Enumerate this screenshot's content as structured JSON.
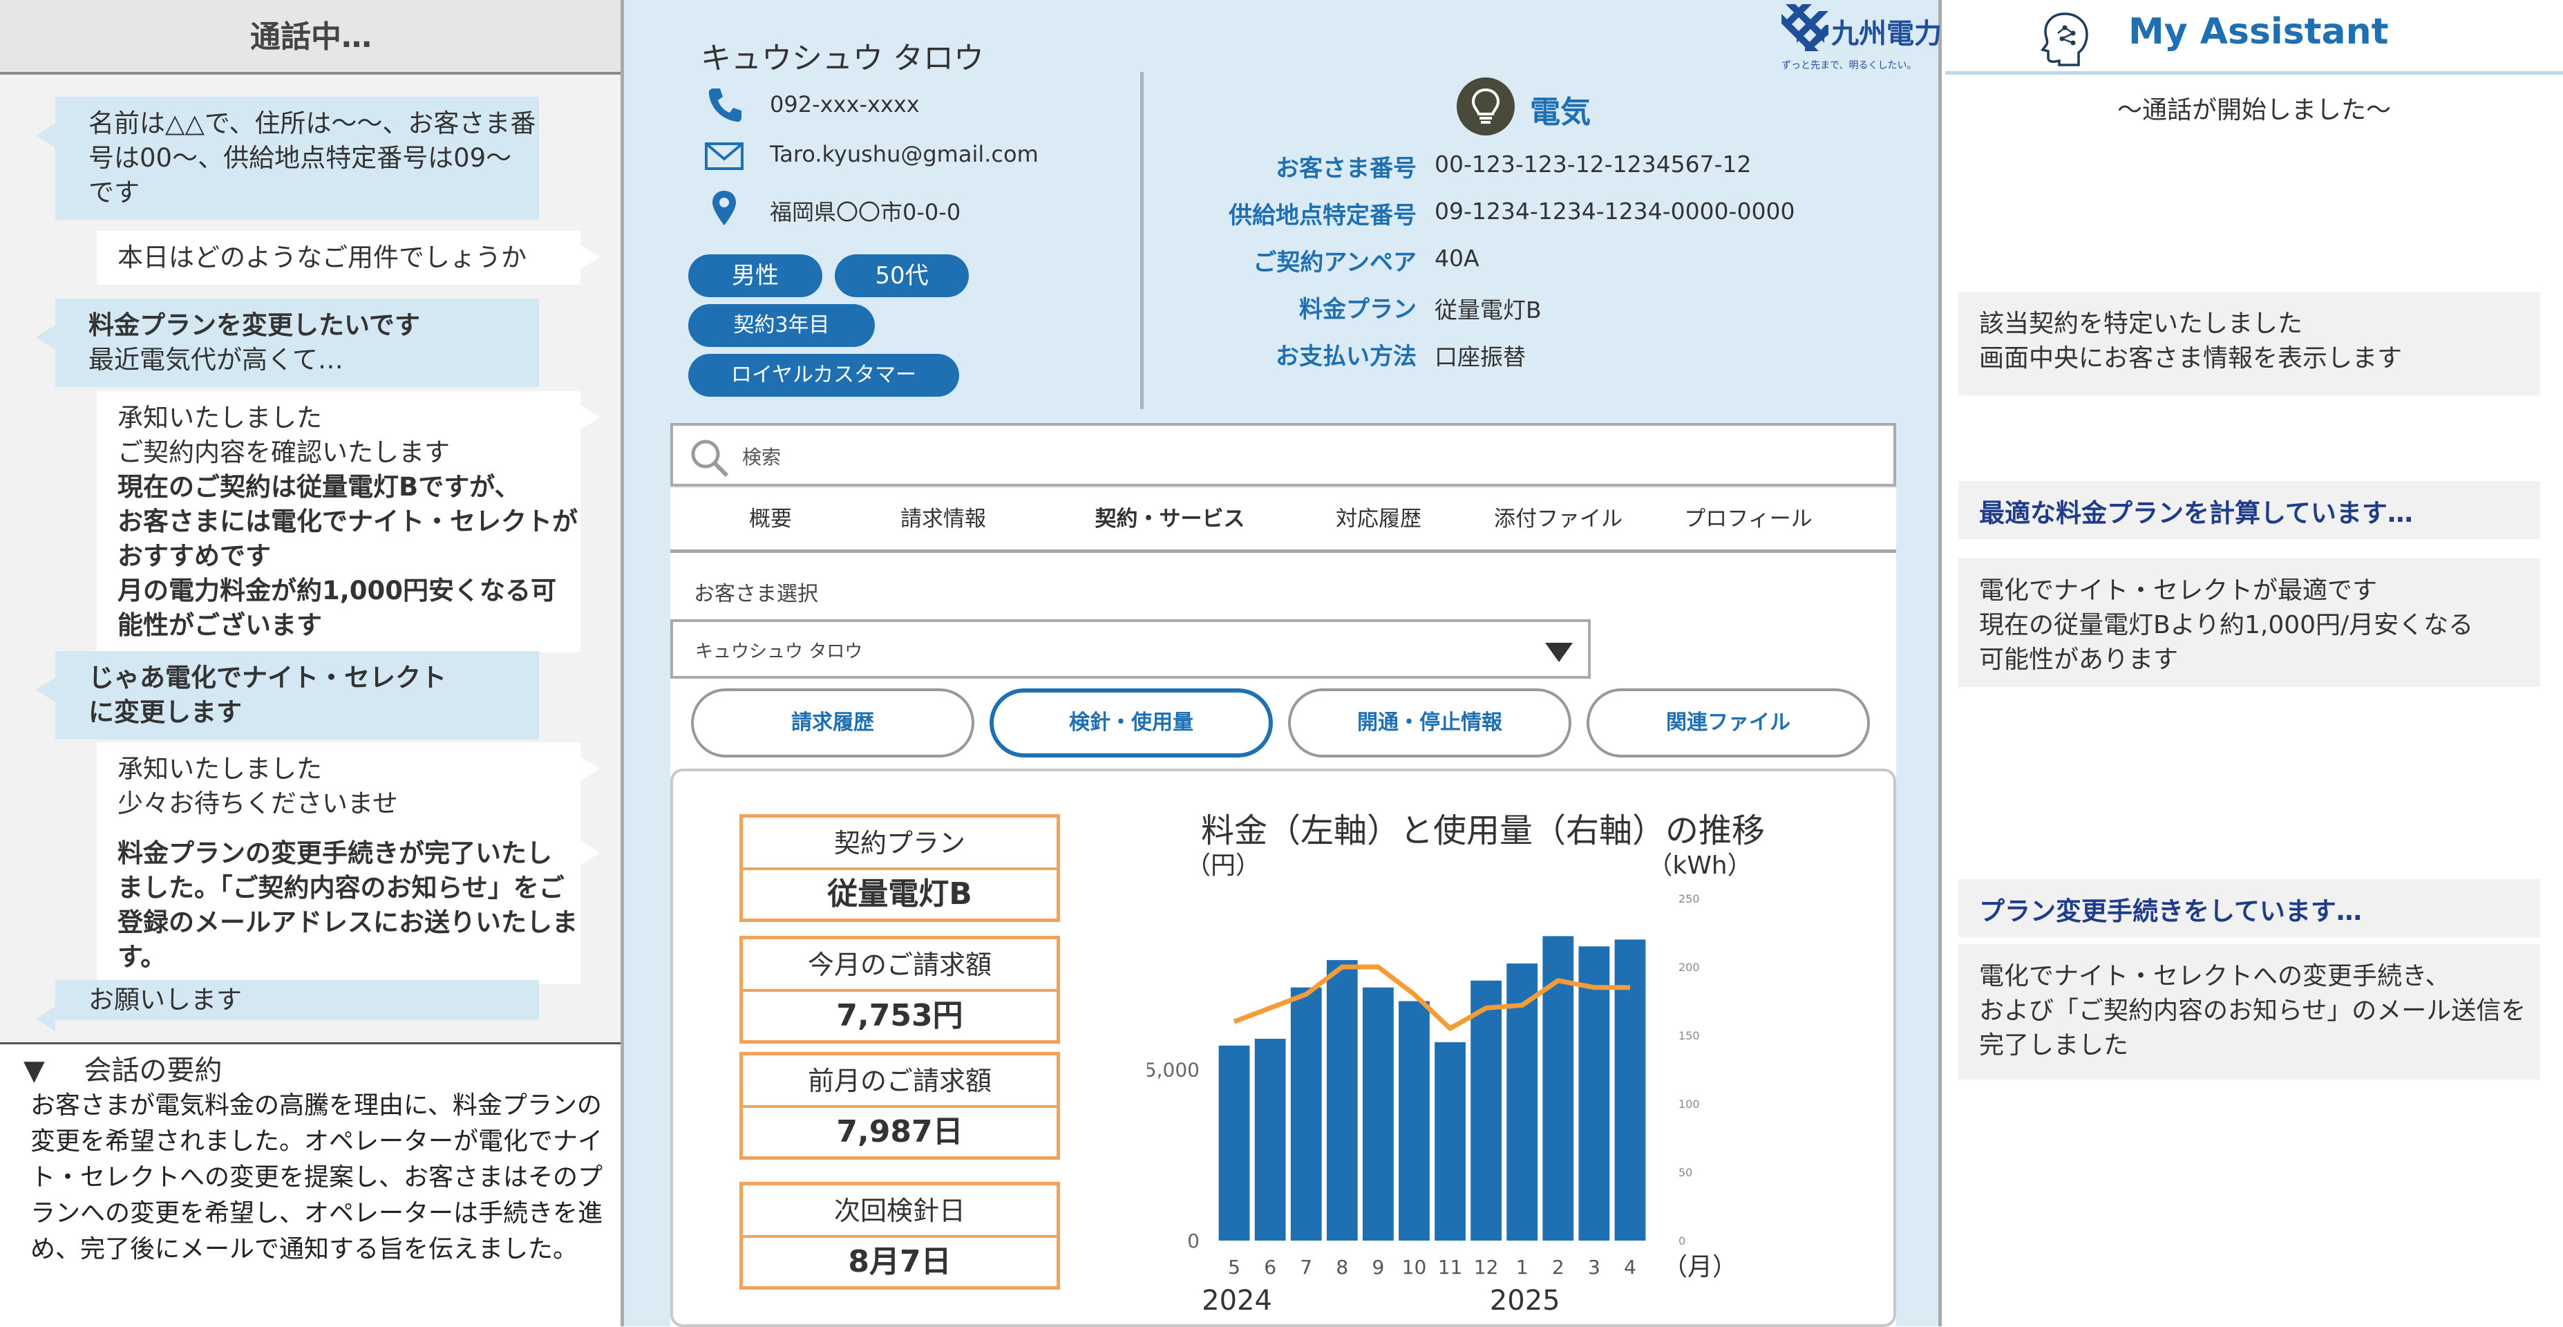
{
  "left_panel": {
    "header": "通話中…",
    "messages": [
      {
        "speaker": "customer",
        "lines": [
          "名前は△△で、住所は～～、お客さま番",
          "号は00～、供給地点特定番号は09～",
          "です"
        ]
      },
      {
        "speaker": "operator",
        "lines": [
          "本日はどのようなご用件でしょうか"
        ]
      },
      {
        "speaker": "customer",
        "lines": [
          "料金プランを変更したいです",
          "最近電気代が高くて…"
        ]
      },
      {
        "speaker": "operator",
        "lines": [
          "承知いたしました",
          "ご契約内容を確認いたします",
          "現在のご契約は従量電灯Bですが、",
          "お客さまには電化でナイト・セレクトが",
          "おすすめです",
          "月の電力料金が約1,000円安くなる可",
          "能性がございます"
        ]
      },
      {
        "speaker": "customer",
        "lines": [
          "じゃあ電化でナイト・セレクト",
          "に変更します"
        ]
      },
      {
        "speaker": "operator",
        "lines": [
          "承知いたしました",
          "少々お待ちくださいませ"
        ]
      },
      {
        "speaker": "operator",
        "lines": [
          "料金プランの変更手続きが完了いたし",
          "ました。「ご契約内容のお知らせ」をご",
          "登録のメールアドレスにお送りいたしま",
          "す。"
        ]
      },
      {
        "speaker": "customer",
        "lines": [
          "お願いします"
        ]
      }
    ],
    "summary_toggle": "▼",
    "summary_title": "会話の要約",
    "summary_text": "お客さまが電気料金の高騰を理由に、料金プランの変更を希望されました。オペレーターが電化でナイト・セレクトへの変更を提案し、お客さまはそのプランへの変更を希望し、オペレーターは手続きを進め、完了後にメールで通知する旨を伝えました。"
  },
  "brand": {
    "name": "九州電力",
    "tagline": "ずっと先まで、明るくしたい。",
    "color": "#1f4e9a"
  },
  "customer": {
    "name": "キュウシュウ タロウ",
    "phone": "092-xxx-xxxx",
    "email": "Taro.kyushu@gmail.com",
    "address": "福岡県〇〇市0-0-0",
    "tags": [
      "男性",
      "50代",
      "契約3年目",
      "ロイヤルカスタマー"
    ],
    "icons": [
      "phone-icon",
      "mail-icon",
      "location-pin-icon"
    ]
  },
  "contract": {
    "category": "電気",
    "fields": [
      {
        "label": "お客さま番号",
        "value": "00-123-123-12-1234567-12"
      },
      {
        "label": "供給地点特定番号",
        "value": "09-1234-1234-1234-0000-0000"
      },
      {
        "label": "ご契約アンペア",
        "value": "40A"
      },
      {
        "label": "料金プラン",
        "value": "従量電灯B"
      },
      {
        "label": "お支払い方法",
        "value": "口座振替"
      }
    ]
  },
  "search": {
    "placeholder": "検索"
  },
  "tabs": [
    {
      "label": "概要",
      "active": false
    },
    {
      "label": "請求情報",
      "active": false
    },
    {
      "label": "契約・サービス",
      "active": true
    },
    {
      "label": "対応履歴",
      "active": false
    },
    {
      "label": "添付ファイル",
      "active": false
    },
    {
      "label": "プロフィール",
      "active": false
    }
  ],
  "customer_select": {
    "label": "お客さま選択",
    "value": "キュウシュウ タロウ"
  },
  "sub_buttons": [
    {
      "label": "請求履歴",
      "active": false
    },
    {
      "label": "検針・使用量",
      "active": true
    },
    {
      "label": "開通・停止情報",
      "active": false
    },
    {
      "label": "関連ファイル",
      "active": false
    }
  ],
  "kpi": [
    {
      "label": "契約プラン",
      "value": "従量電灯B"
    },
    {
      "label": "今月のご請求額",
      "value": "7,753円"
    },
    {
      "label": "前月のご請求額",
      "value": "7,987日"
    },
    {
      "label": "次回検針日",
      "value": "8月7日"
    }
  ],
  "chart_data": {
    "type": "bar+line",
    "title": "料金（左軸）と使用量（右軸）の推移",
    "left_axis_unit": "（円）",
    "right_axis_unit": "（kWh）",
    "x_unit": "（月）",
    "categories": [
      "5",
      "6",
      "7",
      "8",
      "9",
      "10",
      "11",
      "12",
      "1",
      "2",
      "3",
      "4"
    ],
    "year_labels": [
      {
        "label": "2024",
        "at_index": 0
      },
      {
        "label": "2025",
        "at_index": 8
      }
    ],
    "bars": {
      "axis": "left",
      "color": "#1f6fb3",
      "values": [
        5700,
        5900,
        7400,
        8200,
        7400,
        7000,
        5800,
        7600,
        8100,
        8900,
        8600,
        8800
      ]
    },
    "line": {
      "axis": "right",
      "color": "#f39c38",
      "values": [
        160,
        170,
        180,
        200,
        200,
        180,
        155,
        170,
        172,
        190,
        185,
        185
      ]
    },
    "left_ticks": [
      0,
      5000
    ],
    "left_tick_labels": [
      "0",
      "5,000"
    ],
    "left_range": [
      0,
      10000
    ],
    "right_ticks": [
      0,
      50,
      100,
      150,
      200,
      250
    ],
    "right_range": [
      0,
      250
    ],
    "grid": false
  },
  "assistant": {
    "title": "My Assistant",
    "call_start": "～通話が開始しました～",
    "cards": [
      {
        "style": "body",
        "lines": [
          "該当契約を特定いたしました",
          "画面中央にお客さま情報を表示します"
        ]
      },
      {
        "style": "head",
        "lines": [
          "最適な料金プランを計算しています…"
        ]
      },
      {
        "style": "body",
        "lines": [
          "電化でナイト・セレクトが最適です",
          "現在の従量電灯Bより約1,000円/月安くなる",
          "可能性があります"
        ]
      },
      {
        "style": "head",
        "lines": [
          "プラン変更手続きをしています…"
        ]
      },
      {
        "style": "body",
        "lines": [
          "電化でナイト・セレクトへの変更手続き、",
          "および「ご契約内容のお知らせ」のメール送信を",
          "完了しました"
        ]
      }
    ]
  }
}
